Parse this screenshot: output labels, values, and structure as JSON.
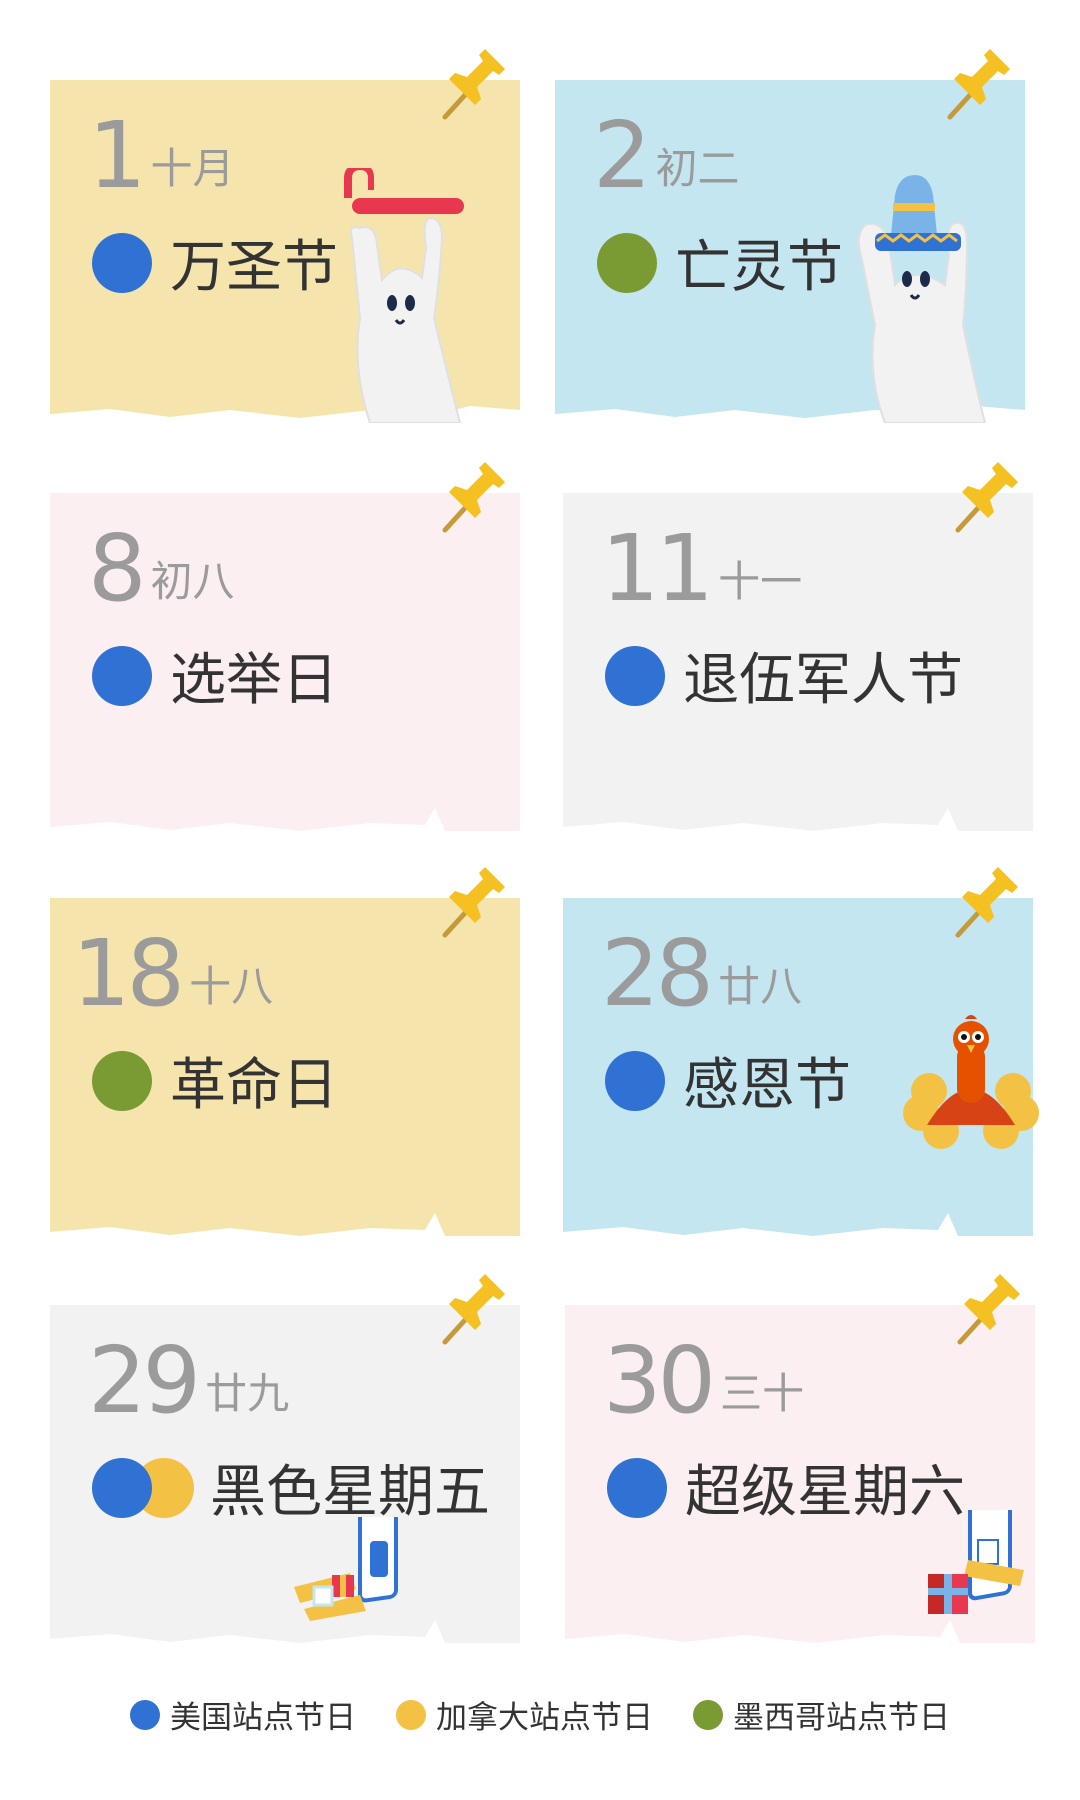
{
  "colors": {
    "us": "#2f72d4",
    "ca": "#f3c245",
    "mx": "#7a9a33",
    "yellow_card": "#f5e5ad",
    "blue_card": "#c3e6f0",
    "pink_card": "#fbeff1",
    "gray_card": "#f2f2f2",
    "pin": "#f5c022"
  },
  "cards": [
    {
      "day": "1",
      "lunar": "十月",
      "holiday": "万圣节",
      "region": "us",
      "bg": "yellow_card",
      "illustration": "ghost-with-candy-cane-icon"
    },
    {
      "day": "2",
      "lunar": "初二",
      "holiday": "亡灵节",
      "region": "mx",
      "bg": "blue_card",
      "illustration": "ghost-with-sombrero-icon"
    },
    {
      "day": "8",
      "lunar": "初八",
      "holiday": "选举日",
      "region": "us",
      "bg": "pink_card"
    },
    {
      "day": "11",
      "lunar": "十一",
      "holiday": "退伍军人节",
      "region": "us",
      "bg": "gray_card"
    },
    {
      "day": "18",
      "lunar": "十八",
      "holiday": "革命日",
      "region": "mx",
      "bg": "yellow_card"
    },
    {
      "day": "28",
      "lunar": "廿八",
      "holiday": "感恩节",
      "region": "us",
      "bg": "blue_card",
      "illustration": "turkey-icon"
    },
    {
      "day": "29",
      "lunar": "廿九",
      "holiday": "黑色星期五",
      "region": "us+ca",
      "bg": "gray_card",
      "illustration": "shopping-phone-icon"
    },
    {
      "day": "30",
      "lunar": "三十",
      "holiday": "超级星期六",
      "region": "us",
      "bg": "pink_card",
      "illustration": "shopping-phone-gift-icon"
    }
  ],
  "legend": [
    {
      "label": "美国站点节日",
      "region": "us"
    },
    {
      "label": "加拿大站点节日",
      "region": "ca"
    },
    {
      "label": "墨西哥站点节日",
      "region": "mx"
    }
  ]
}
